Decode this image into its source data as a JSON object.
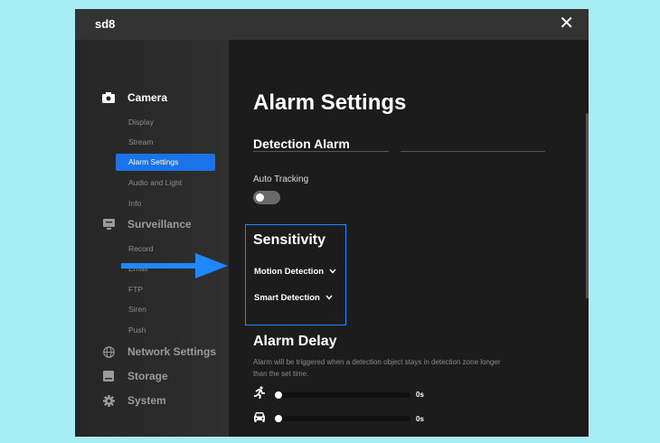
{
  "window": {
    "title": "sd8",
    "close_label": "✕"
  },
  "sidebar": {
    "sections": [
      {
        "name": "camera",
        "label": "Camera",
        "icon": "camera-icon",
        "active": true,
        "items": [
          "Display",
          "Stream",
          "Alarm Settings",
          "Audio and Light",
          "Info"
        ]
      },
      {
        "name": "surveillance",
        "label": "Surveillance",
        "icon": "monitor-icon",
        "items": [
          "Record",
          "Email",
          "FTP",
          "Siren",
          "Push"
        ]
      },
      {
        "name": "network",
        "label": "Network Settings",
        "icon": "globe-icon"
      },
      {
        "name": "storage",
        "label": "Storage",
        "icon": "storage-icon"
      },
      {
        "name": "system",
        "label": "System",
        "icon": "gear-icon"
      }
    ],
    "selected_item": "Alarm Settings"
  },
  "main": {
    "page_title": "Alarm Settings",
    "detection_alarm": {
      "heading": "Detection Alarm",
      "auto_tracking_label": "Auto Tracking",
      "auto_tracking_on": false
    },
    "sensitivity": {
      "heading": "Sensitivity",
      "motion_detection": "Motion Detection",
      "smart_detection": "Smart Detection"
    },
    "alarm_delay": {
      "heading": "Alarm Delay",
      "description": "Alarm will be triggered when a detection object stays in detection zone longer than the set time.",
      "sliders": [
        {
          "icon": "running-person-icon",
          "value_label": "0s",
          "value": 0
        },
        {
          "icon": "car-icon",
          "value_label": "0s",
          "value": 0
        }
      ]
    }
  },
  "colors": {
    "accent": "#1a73e8",
    "highlight_border": "#1e88ff",
    "annotation_arrow": "#1e88ff",
    "background": "#a6eef3"
  }
}
